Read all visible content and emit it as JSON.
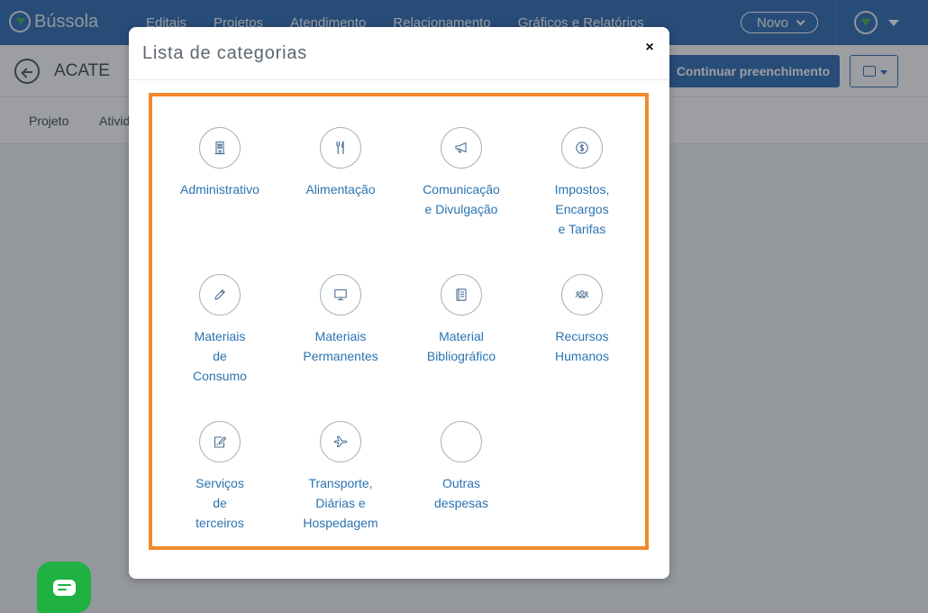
{
  "app": {
    "logo_text": "Bússola",
    "nav": [
      "Editais",
      "Projetos",
      "Atendimento",
      "Relacionamento",
      "Gráficos e Relatórios"
    ],
    "new_button": "Novo"
  },
  "project": {
    "title": "ACATE",
    "continue_button": "Continuar preenchimento",
    "tabs": [
      "Projeto",
      "Ativid"
    ]
  },
  "modal": {
    "title": "Lista de categorias",
    "close_label": "×",
    "categories": [
      {
        "label": "Administrativo",
        "icon": "building-icon"
      },
      {
        "label": "Alimentação",
        "icon": "utensils-icon"
      },
      {
        "label": "Comunicação\ne Divulgação",
        "icon": "megaphone-icon"
      },
      {
        "label": "Impostos,\nEncargos\ne Tarifas",
        "icon": "dollar-coin-icon"
      },
      {
        "label": "Materiais\nde\nConsumo",
        "icon": "pencil-icon"
      },
      {
        "label": "Materiais\nPermanentes",
        "icon": "monitor-icon"
      },
      {
        "label": "Material\nBibliográfico",
        "icon": "book-icon"
      },
      {
        "label": "Recursos\nHumanos",
        "icon": "users-icon"
      },
      {
        "label": "Serviços\nde\nterceiros",
        "icon": "edit-document-icon"
      },
      {
        "label": "Transporte,\nDiárias e\nHospedagem",
        "icon": "airplane-icon"
      },
      {
        "label": "Outras\ndespesas",
        "icon": "blank-icon"
      }
    ]
  },
  "colors": {
    "brand_blue": "#2d6ab4",
    "highlight_orange": "#f28a2c",
    "link_blue": "#2a73b0",
    "chat_green": "#1fb141"
  }
}
